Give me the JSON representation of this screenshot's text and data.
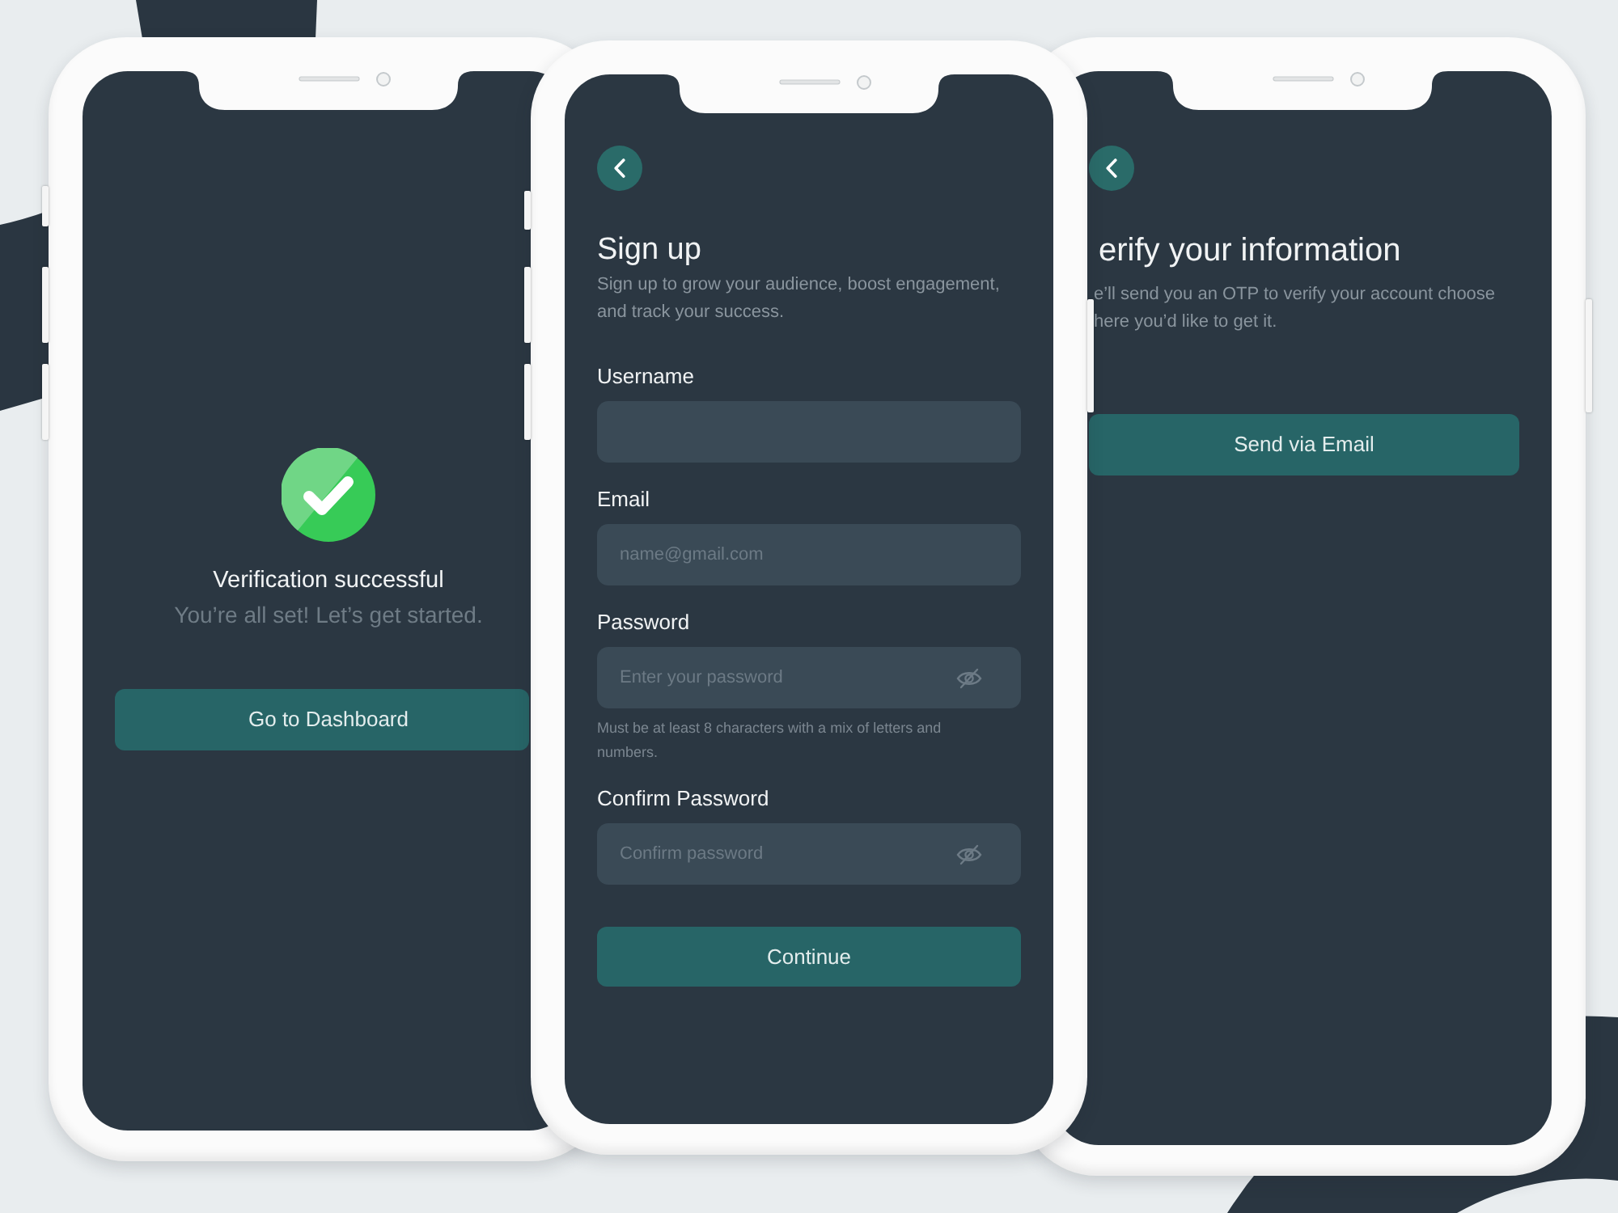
{
  "screens": [
    {
      "kind": "verification_success",
      "title": "Verification successful",
      "subtitle": "You’re all set! Let’s get started.",
      "button": "Go to Dashboard"
    },
    {
      "kind": "sign_up",
      "title": "Sign up",
      "subtitle": "Sign up to grow your audience, boost engagement, and track your success.",
      "fields": [
        {
          "kind": "text",
          "label": "Username"
        },
        {
          "kind": "text",
          "label": "Email",
          "placeholder": "name@gmail.com"
        },
        {
          "kind": "password",
          "label": "Password",
          "placeholder": "Enter your password",
          "hint": "Must be at least 8 characters with a mix of letters and numbers."
        },
        {
          "kind": "password",
          "label": "Confirm Password",
          "placeholder": "Confirm password"
        }
      ],
      "button": "Continue"
    },
    {
      "kind": "verify",
      "title": "erify your information",
      "subtitle_lines": [
        "e’ll send you an OTP to verify your account choose",
        "here you’d like to get it."
      ],
      "button": "Send via Email"
    }
  ]
}
